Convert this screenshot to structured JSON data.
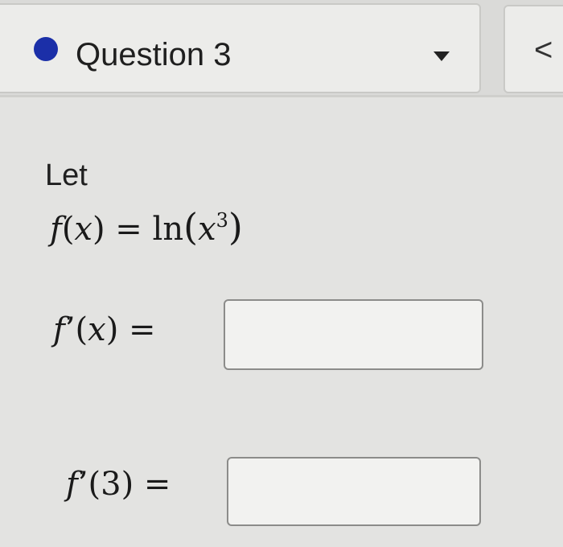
{
  "header": {
    "question_title": "Question 3",
    "status_color": "#1b2fa8",
    "status_icon": "filled-circle",
    "dropdown_icon": "caret-down-icon",
    "prev_label": "<"
  },
  "problem": {
    "intro": "Let",
    "function": {
      "name": "f",
      "var": "x",
      "definition_func": "ln",
      "exponent": "3"
    },
    "questions": [
      {
        "label_func": "f",
        "label_prime": "’",
        "label_arg": "x",
        "equals": "=",
        "answer_value": ""
      },
      {
        "label_func": "f",
        "label_prime": "’",
        "label_arg": "3",
        "equals": "=",
        "answer_value": ""
      }
    ]
  }
}
